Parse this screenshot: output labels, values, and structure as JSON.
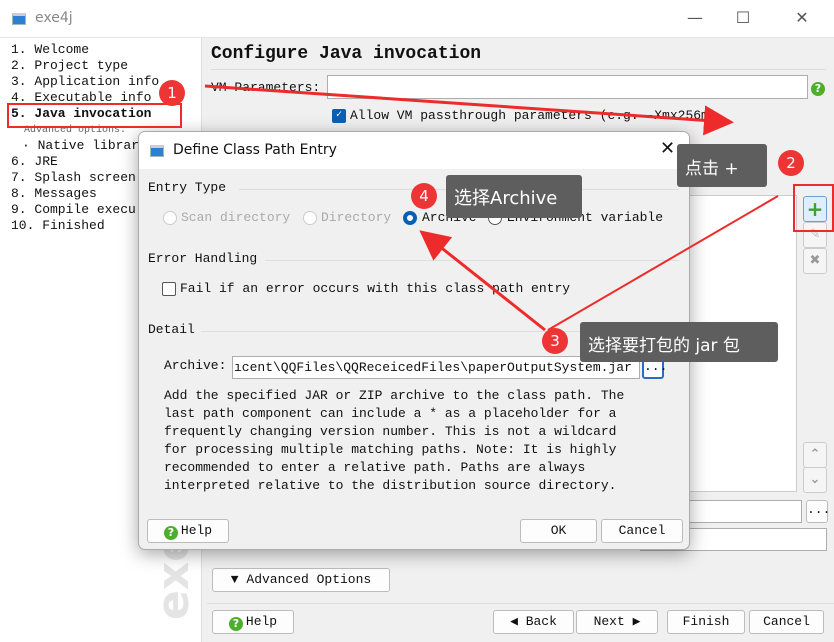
{
  "window": {
    "title": "exe4j",
    "controls": [
      "minimize",
      "maximize",
      "close"
    ]
  },
  "sidebar": {
    "items": [
      {
        "label": "1. Welcome"
      },
      {
        "label": "2. Project type"
      },
      {
        "label": "3. Application info"
      },
      {
        "label": "4. Executable info"
      },
      {
        "label": "5. Java invocation",
        "active": true
      },
      {
        "label": "Advanced options:"
      },
      {
        "label": "· Native librar"
      },
      {
        "label": "6. JRE"
      },
      {
        "label": "7. Splash screen"
      },
      {
        "label": "8. Messages"
      },
      {
        "label": "9. Compile execu"
      },
      {
        "label": "10. Finished"
      }
    ]
  },
  "main": {
    "title": "Configure Java invocation",
    "vm_label": "VM Parameters:",
    "vm_value": "",
    "allow_passthrough": {
      "label": "Allow VM passthrough parameters (e.g. -Xmx256m)",
      "checked": true
    },
    "browse_label": "...",
    "advanced_options": "Advanced Options",
    "buttons": {
      "help": "Help",
      "back": "Back",
      "next": "Next",
      "finish": "Finish",
      "cancel": "Cancel"
    },
    "watermark": "exe4j"
  },
  "dialog": {
    "title": "Define Class Path Entry",
    "entry_type_label": "Entry Type",
    "entry_types": [
      {
        "label": "Scan directory",
        "selected": false,
        "enabled": false
      },
      {
        "label": "Directory",
        "selected": false,
        "enabled": false
      },
      {
        "label": "Archive",
        "selected": true,
        "enabled": true
      },
      {
        "label": "Environment variable",
        "selected": false,
        "enabled": true
      }
    ],
    "error_handling_label": "Error Handling",
    "fail_checkbox": {
      "label": "Fail if an error occurs with this class path entry",
      "checked": false
    },
    "detail_label": "Detail",
    "archive_label": "Archive:",
    "archive_value": "ıcent\\QQFiles\\QQReceicedFiles\\paperOutputSystem.jar",
    "browse_label": "...",
    "description": "Add the specified JAR or ZIP archive to the class path. The\nlast path component can include a * as a placeholder for a\nfrequently changing version number. This is not a wildcard\nfor processing multiple matching paths. Note: It is highly\nrecommended to enter a relative path. Paths are always\ninterpreted relative to the distribution source directory.",
    "help": "Help",
    "ok": "OK",
    "cancel": "Cancel"
  },
  "annotations": {
    "badges": [
      "1",
      "2",
      "3",
      "4"
    ],
    "tip2": "点击 +",
    "tip3": "选择要打包的 jar 包",
    "tip4": "选择Archive",
    "color": "#ee2b2b"
  }
}
